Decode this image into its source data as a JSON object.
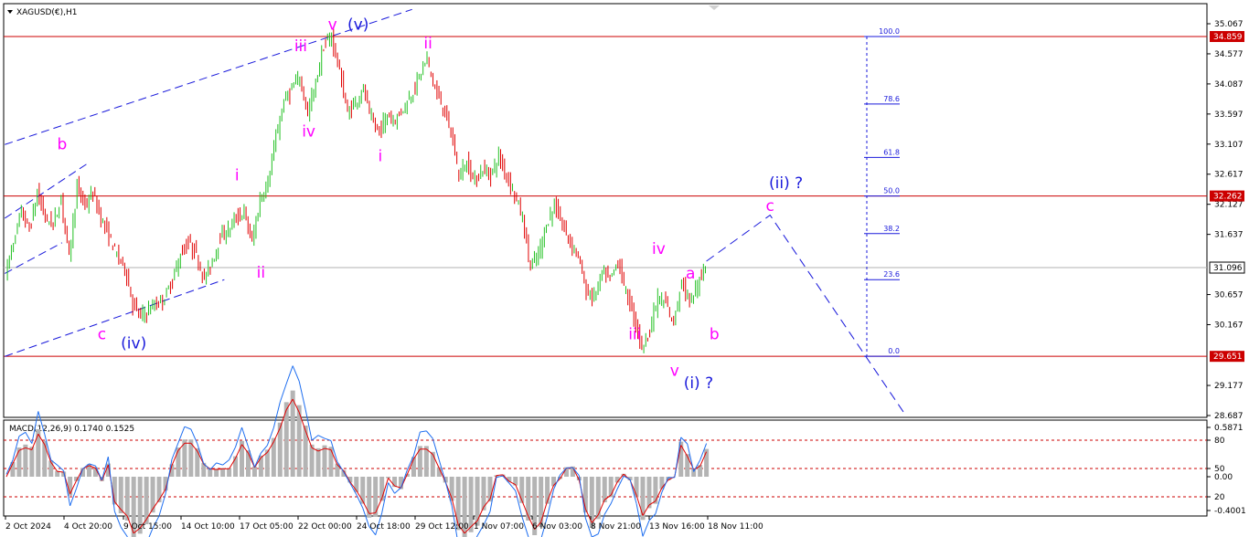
{
  "chart_data": {
    "type": "candlestick",
    "symbol": "XAGUSD(€),H1",
    "price_axis": {
      "ylim": [
        28.687,
        35.067
      ],
      "tick_labels": [
        "35.067",
        "34.577",
        "34.087",
        "33.597",
        "33.107",
        "32.617",
        "32.127",
        "31.637",
        "30.657",
        "30.167",
        "29.177",
        "28.687"
      ],
      "tick_values": [
        35.067,
        34.577,
        34.087,
        33.597,
        33.107,
        32.617,
        32.127,
        31.637,
        30.657,
        30.167,
        29.177,
        28.687
      ],
      "current_price": "31.096"
    },
    "horizontal_levels": [
      {
        "label": "34.859",
        "value": 34.859,
        "color": "#cc0000"
      },
      {
        "label": "32.262",
        "value": 32.262,
        "color": "#cc0000"
      },
      {
        "label": "29.651",
        "value": 29.651,
        "color": "#cc0000"
      }
    ],
    "time_axis": {
      "labels": [
        "2 Oct 2024",
        "4 Oct 20:00",
        "9 Oct 15:00",
        "14 Oct 10:00",
        "17 Oct 05:00",
        "22 Oct 00:00",
        "24 Oct 18:00",
        "29 Oct 12:00",
        "1 Nov 07:00",
        "6 Nov 03:00",
        "8 Nov 21:00",
        "13 Nov 16:00",
        "18 Nov 11:00"
      ]
    },
    "price_path": [
      [
        0,
        31.0
      ],
      [
        1,
        31.5
      ],
      [
        2,
        32.0
      ],
      [
        3,
        31.7
      ],
      [
        4,
        32.3
      ],
      [
        5,
        31.9
      ],
      [
        6,
        31.8
      ],
      [
        7,
        32.2
      ],
      [
        8,
        31.3
      ],
      [
        9,
        32.4
      ],
      [
        10,
        32.1
      ],
      [
        11,
        32.3
      ],
      [
        12,
        31.9
      ],
      [
        13,
        31.6
      ],
      [
        14,
        31.3
      ],
      [
        15,
        31.1
      ],
      [
        16,
        30.5
      ],
      [
        17,
        30.3
      ],
      [
        18,
        30.4
      ],
      [
        19,
        30.5
      ],
      [
        20,
        30.6
      ],
      [
        21,
        30.9
      ],
      [
        22,
        31.3
      ],
      [
        23,
        31.5
      ],
      [
        24,
        31.3
      ],
      [
        25,
        30.9
      ],
      [
        26,
        31.2
      ],
      [
        27,
        31.6
      ],
      [
        28,
        31.7
      ],
      [
        29,
        31.9
      ],
      [
        30,
        32.0
      ],
      [
        31,
        31.5
      ],
      [
        32,
        32.2
      ],
      [
        33,
        32.5
      ],
      [
        34,
        33.2
      ],
      [
        35,
        33.8
      ],
      [
        36,
        34.0
      ],
      [
        37,
        34.2
      ],
      [
        38,
        33.6
      ],
      [
        39,
        34.1
      ],
      [
        40,
        34.7
      ],
      [
        41,
        34.85
      ],
      [
        42,
        34.3
      ],
      [
        43,
        33.6
      ],
      [
        44,
        33.8
      ],
      [
        45,
        34.0
      ],
      [
        46,
        33.5
      ],
      [
        47,
        33.3
      ],
      [
        48,
        33.6
      ],
      [
        49,
        33.5
      ],
      [
        50,
        33.7
      ],
      [
        51,
        33.9
      ],
      [
        52,
        34.2
      ],
      [
        53,
        34.5
      ],
      [
        54,
        34.0
      ],
      [
        55,
        33.7
      ],
      [
        56,
        33.3
      ],
      [
        57,
        32.6
      ],
      [
        58,
        32.8
      ],
      [
        59,
        32.5
      ],
      [
        60,
        32.7
      ],
      [
        61,
        32.6
      ],
      [
        62,
        32.9
      ],
      [
        63,
        32.6
      ],
      [
        64,
        32.3
      ],
      [
        65,
        31.9
      ],
      [
        66,
        31.1
      ],
      [
        67,
        31.3
      ],
      [
        68,
        31.8
      ],
      [
        69,
        32.1
      ],
      [
        70,
        31.8
      ],
      [
        71,
        31.5
      ],
      [
        72,
        31.3
      ],
      [
        73,
        30.7
      ],
      [
        74,
        30.6
      ],
      [
        75,
        31.0
      ],
      [
        76,
        30.9
      ],
      [
        77,
        31.2
      ],
      [
        78,
        30.7
      ],
      [
        79,
        30.3
      ],
      [
        80,
        29.8
      ],
      [
        81,
        30.1
      ],
      [
        82,
        30.6
      ],
      [
        83,
        30.5
      ],
      [
        84,
        30.2
      ],
      [
        85,
        30.9
      ],
      [
        86,
        30.5
      ],
      [
        87,
        30.8
      ],
      [
        88,
        31.2
      ]
    ],
    "wave_labels": [
      {
        "text": "v",
        "color": "#ff00ff",
        "i": 41,
        "price": 34.85,
        "pos": "above"
      },
      {
        "text": "(v)",
        "color": "#1a1adb",
        "i": 41,
        "price": 34.85,
        "pos": "above",
        "dx": 28
      },
      {
        "text": "iii",
        "color": "#ff00ff",
        "i": 37,
        "price": 34.5,
        "pos": "above"
      },
      {
        "text": "ii",
        "color": "#ff00ff",
        "i": 53,
        "price": 34.55,
        "pos": "above"
      },
      {
        "text": "iv",
        "color": "#ff00ff",
        "i": 38,
        "price": 33.5,
        "pos": "below"
      },
      {
        "text": "i",
        "color": "#ff00ff",
        "i": 47,
        "price": 33.1,
        "pos": "below"
      },
      {
        "text": "b",
        "color": "#ff00ff",
        "i": 7,
        "price": 32.9,
        "pos": "above"
      },
      {
        "text": "i",
        "color": "#ff00ff",
        "i": 29,
        "price": 32.4,
        "pos": "above"
      },
      {
        "text": "ii",
        "color": "#ff00ff",
        "i": 32,
        "price": 31.2,
        "pos": "below"
      },
      {
        "text": "c",
        "color": "#ff00ff",
        "i": 12,
        "price": 30.2,
        "pos": "below"
      },
      {
        "text": "(iv)",
        "color": "#1a1adb",
        "i": 16,
        "price": 30.05,
        "pos": "below"
      },
      {
        "text": "iv",
        "color": "#ff00ff",
        "i": 82,
        "price": 31.2,
        "pos": "above"
      },
      {
        "text": "iii",
        "color": "#ff00ff",
        "i": 79,
        "price": 30.2,
        "pos": "below"
      },
      {
        "text": "v",
        "color": "#ff00ff",
        "i": 84,
        "price": 29.6,
        "pos": "below"
      },
      {
        "text": "(i) ?",
        "color": "#1a1adb",
        "i": 87,
        "price": 29.4,
        "pos": "below"
      },
      {
        "text": "a",
        "color": "#ff00ff",
        "i": 86,
        "price": 30.8,
        "pos": "above"
      },
      {
        "text": "b",
        "color": "#ff00ff",
        "i": 89,
        "price": 30.2,
        "pos": "below"
      },
      {
        "text": "c",
        "color": "#ff00ff",
        "i": 96,
        "price": 31.9,
        "pos": "above"
      },
      {
        "text": "(ii) ?",
        "color": "#1a1adb",
        "i": 98,
        "price": 32.27,
        "pos": "above"
      }
    ],
    "fibonacci": {
      "levels": [
        "100.0",
        "78.6",
        "61.8",
        "50.0",
        "38.2",
        "23.6",
        "0.0"
      ],
      "values": [
        34.859,
        33.76,
        32.89,
        32.262,
        31.65,
        30.9,
        29.651
      ]
    },
    "projection": [
      [
        88,
        31.2
      ],
      [
        96,
        31.95
      ],
      [
        113,
        28.7
      ]
    ],
    "macd": {
      "label": "MACD(12,26,9) 0.1740 0.1525",
      "params": "MACD(12,26,9)",
      "macd_value": 0.174,
      "signal_value": 0.1525,
      "ylim": [
        -0.4001,
        0.5871
      ],
      "tick_labels": [
        "0.5871",
        "80",
        "50",
        "0.00",
        "20",
        "-0.4001"
      ],
      "levels": [
        80,
        50,
        20
      ]
    }
  },
  "colors": {
    "bull": "#22c022",
    "bear": "#e00000",
    "level": "#cc0000",
    "fib": "#1a1adb",
    "projection": "#1a1adb",
    "channel": "#1a1adb",
    "macd_hist": "#b4b4b4",
    "macd_signal": "#e00000",
    "stoch": "#1e6ef0"
  }
}
